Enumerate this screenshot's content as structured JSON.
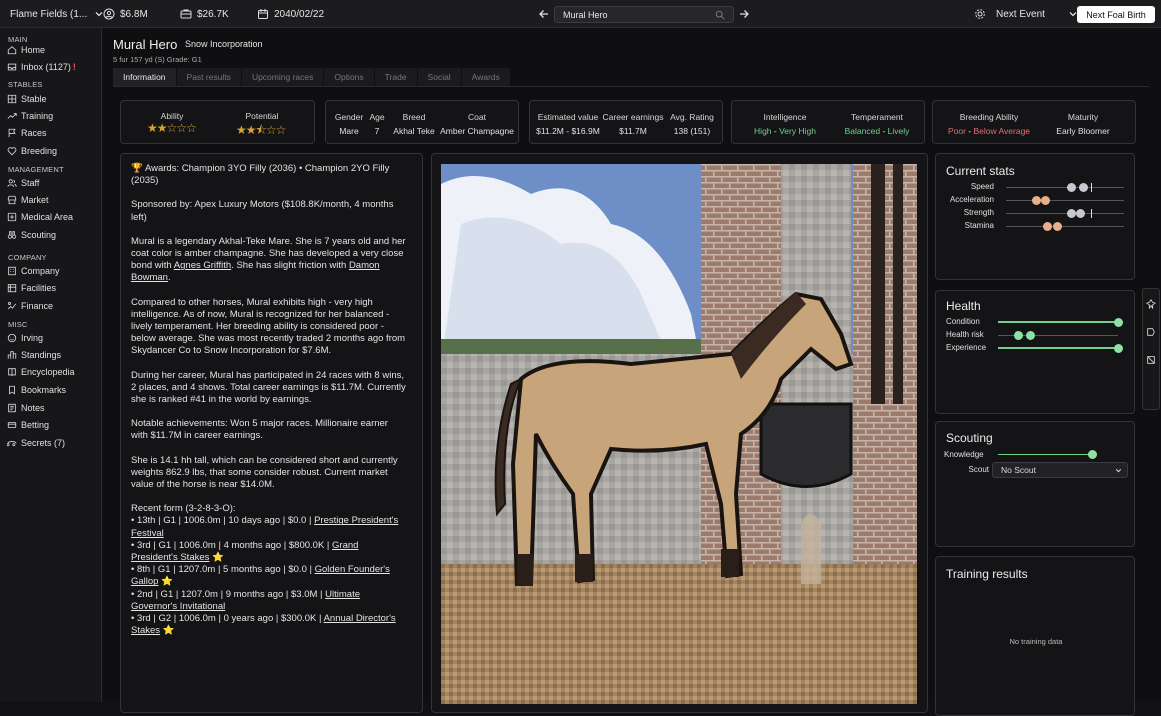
{
  "topbar": {
    "stable_name": "Flame Fields (1...",
    "money": "$6.8M",
    "weekly": "$26.7K",
    "date": "2040/02/22",
    "search_value": "Mural Hero",
    "next_event": "Next Event",
    "next_foal_birth": "Next Foal Birth"
  },
  "sidebar": {
    "sections": [
      {
        "title": "MAIN",
        "items": [
          {
            "label": "Home",
            "icon": "home-icon"
          },
          {
            "label": "Inbox (1127)",
            "icon": "inbox-icon",
            "alert": "!"
          }
        ]
      },
      {
        "title": "STABLES",
        "items": [
          {
            "label": "Stable",
            "icon": "grid-icon"
          },
          {
            "label": "Training",
            "icon": "trend-icon"
          },
          {
            "label": "Races",
            "icon": "flag-icon"
          },
          {
            "label": "Breeding",
            "icon": "heart-icon"
          }
        ]
      },
      {
        "title": "MANAGEMENT",
        "items": [
          {
            "label": "Staff",
            "icon": "users-icon"
          },
          {
            "label": "Market",
            "icon": "store-icon"
          },
          {
            "label": "Medical Area",
            "icon": "medical-icon"
          },
          {
            "label": "Scouting",
            "icon": "binoculars-icon"
          }
        ]
      },
      {
        "title": "COMPANY",
        "items": [
          {
            "label": "Company",
            "icon": "building-icon"
          },
          {
            "label": "Facilities",
            "icon": "facility-icon"
          },
          {
            "label": "Finance",
            "icon": "finance-icon"
          }
        ]
      },
      {
        "title": "MISC",
        "items": [
          {
            "label": "Irving",
            "icon": "bot-icon"
          },
          {
            "label": "Standings",
            "icon": "standings-icon"
          },
          {
            "label": "Encyclopedia",
            "icon": "book-icon"
          },
          {
            "label": "Bookmarks",
            "icon": "bookmark-icon"
          },
          {
            "label": "Notes",
            "icon": "notes-icon"
          },
          {
            "label": "Betting",
            "icon": "betting-icon"
          },
          {
            "label": "Secrets (7)",
            "icon": "secrets-icon"
          }
        ]
      }
    ]
  },
  "horse": {
    "name": "Mural Hero",
    "owner": "Snow Incorporation",
    "subtitle": "5 fur 157 yd (S) Grade: G1"
  },
  "tabs": [
    "Information",
    "Past results",
    "Upcoming races",
    "Options",
    "Trade",
    "Social",
    "Awards"
  ],
  "summary": {
    "ability_label": "Ability",
    "ability_stars": 2,
    "potential_label": "Potential",
    "potential_stars": 2.5,
    "gender_label": "Gender",
    "gender": "Mare",
    "age_label": "Age",
    "age": "7",
    "breed_label": "Breed",
    "breed": "Akhal Teke",
    "coat_label": "Coat",
    "coat": "Amber Champagne",
    "est_label": "Estimated value",
    "est": "$11.2M - $16.9M",
    "career_label": "Career earnings",
    "career": "$11.7M",
    "rating_label": "Avg. Rating",
    "rating": "138 (151)",
    "intel_label": "Intelligence",
    "intel_a": "High",
    "intel_sep": " - ",
    "intel_b": "Very High",
    "temp_label": "Temperament",
    "temp_a": "Balanced",
    "temp_sep": " - ",
    "temp_b": "Lively",
    "breed_ab_label": "Breeding Ability",
    "breed_ab_a": "Poor",
    "breed_ab_sep": " - ",
    "breed_ab_b": "Below Average",
    "maturity_label": "Maturity",
    "maturity": "Early Bloomer"
  },
  "description": {
    "awards": "🏆 Awards: Champion 3YO Filly (2036) • Champion 2YO Filly (2035)",
    "sponsor": "Sponsored by: Apex Luxury Motors ($108.8K/month, 4 months left)",
    "bio_1": "Mural is a legendary Akhal-Teke Mare. She is 7 years old and her coat color is amber champagne. She has developed a very close bond with ",
    "bio_link1": "Agnes Griffith",
    "bio_2": ". She has slight friction with ",
    "bio_link2": "Damon Bowman",
    "bio_3": ".",
    "compare": "Compared to other horses, Mural exhibits high - very high intelligence. As of now, Mural is recognized for her balanced - lively temperament. Her breeding ability is considered poor - below average. She was most recently traded 2 months ago from Skydancer Co to Snow Incorporation for $7.6M.",
    "career": "During her career, Mural has participated in 24 races with 8 wins, 2 places, and 4 shows. Total career earnings is $11.7M. Currently she is ranked #41 in the world by earnings.",
    "notable": "Notable achievements: Won 5 major races. Millionaire earner with $11.7M in career earnings.",
    "physical": "She is 14.1 hh tall, which can be considered short and currently weights 862.9 lbs, that some consider robust. Current market value of the horse is near $14.0M.",
    "form_title": "Recent form (3-2-8-3-O):",
    "form": [
      {
        "text": "• 13th | G1 | 1006.0m | 10 days ago | $0.0 | ",
        "link": "Prestige President's Festival",
        "star": ""
      },
      {
        "text": "• 3rd | G1 | 1006.0m | 4 months ago | $800.0K | ",
        "link": "Grand President's Stakes",
        "star": "⭐"
      },
      {
        "text": "• 8th | G1 | 1207.0m | 5 months ago | $0.0 | ",
        "link": "Golden Founder's Gallop",
        "star": "⭐"
      },
      {
        "text": "• 2nd | G1 | 1207.0m | 9 months ago | $3.0M | ",
        "link": "Ultimate Governor's Invitational",
        "star": ""
      },
      {
        "text": "• 3rd | G2 | 1006.0m | 0 years ago | $300.0K | ",
        "link": "Annual Director's Stakes",
        "star": "⭐"
      }
    ]
  },
  "current_stats": {
    "title": "Current stats",
    "rows": [
      {
        "label": "Speed",
        "low": 0.55,
        "high": 0.65,
        "potential": 0.72,
        "color": "#c8c8d0"
      },
      {
        "label": "Acceleration",
        "low": 0.25,
        "high": 0.33,
        "potential": 0,
        "color": "#e8b08a"
      },
      {
        "label": "Strength",
        "low": 0.55,
        "high": 0.63,
        "potential": 0.72,
        "color": "#c8c8d0"
      },
      {
        "label": "Stamina",
        "low": 0.35,
        "high": 0.43,
        "potential": 0,
        "color": "#e8b08a"
      }
    ]
  },
  "health": {
    "title": "Health",
    "rows": [
      {
        "label": "Condition",
        "value": 1.0
      },
      {
        "label": "Health risk",
        "low": 0.17,
        "high": 0.27
      },
      {
        "label": "Experience",
        "value": 1.0
      }
    ]
  },
  "scouting": {
    "title": "Scouting",
    "knowledge_label": "Knowledge",
    "knowledge": 0.9,
    "scout_label": "Scout",
    "scout_value": "No Scout"
  },
  "training": {
    "title": "Training results",
    "empty": "No training data"
  },
  "colors": {
    "accent_green": "#6fd18a",
    "accent_red": "#e07070",
    "star": "#d9a530"
  }
}
